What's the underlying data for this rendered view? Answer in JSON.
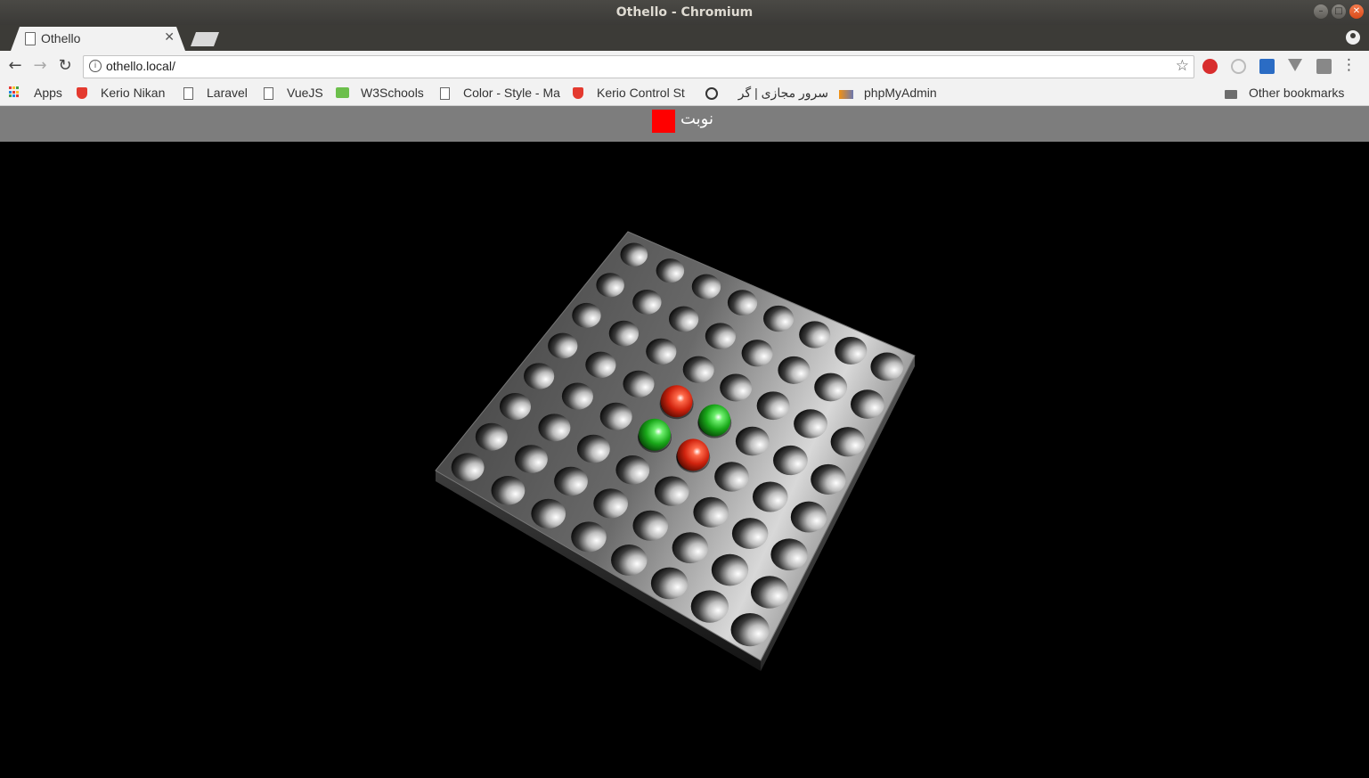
{
  "window": {
    "title": "Othello - Chromium"
  },
  "tab": {
    "label": "Othello"
  },
  "address": {
    "url": "othello.local/"
  },
  "bookmarks": [
    {
      "label": "Apps",
      "icon": "apps-grid-icon"
    },
    {
      "label": "Kerio Nikan",
      "icon": "shield-icon"
    },
    {
      "label": "Laravel",
      "icon": "page-icon"
    },
    {
      "label": "VueJS",
      "icon": "page-icon"
    },
    {
      "label": "W3Schools",
      "icon": "w3schools-icon"
    },
    {
      "label": "Color - Style - Ma",
      "icon": "page-icon"
    },
    {
      "label": "Kerio Control St",
      "icon": "shield-icon"
    },
    {
      "label": "سرور مجازی | گر",
      "icon": "satellite-icon"
    },
    {
      "label": "phpMyAdmin",
      "icon": "pma-icon"
    }
  ],
  "other_bookmarks": "Other bookmarks",
  "game": {
    "turn_label": "نوبت",
    "turn_color": "#ff0000",
    "board": {
      "size": 8,
      "pieces": [
        {
          "row": 3,
          "col": 3,
          "color": "red"
        },
        {
          "row": 3,
          "col": 4,
          "color": "green"
        },
        {
          "row": 4,
          "col": 3,
          "color": "green"
        },
        {
          "row": 4,
          "col": 4,
          "color": "red"
        }
      ]
    },
    "colors": {
      "red": "#e02a12",
      "green": "#1fb21f",
      "background": "#000000",
      "hud": "#7d7d7d"
    }
  }
}
